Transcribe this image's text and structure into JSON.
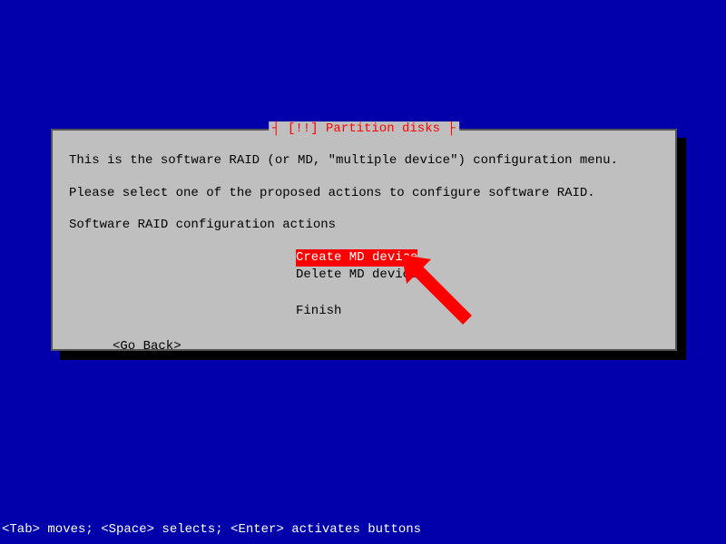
{
  "dialog": {
    "title_prefix": "┤ ",
    "title_marker": "[!!]",
    "title_text": " Partition disks",
    "title_suffix": " ├",
    "line1": "This is the software RAID (or MD, \"multiple device\") configuration menu.",
    "line2": "Please select one of the proposed actions to configure software RAID.",
    "line3": "Software RAID configuration actions",
    "actions": {
      "create": "Create MD device",
      "delete": "Delete MD device",
      "finish": "Finish"
    },
    "go_back": "<Go Back>"
  },
  "footer": "<Tab> moves; <Space> selects; <Enter> activates buttons"
}
